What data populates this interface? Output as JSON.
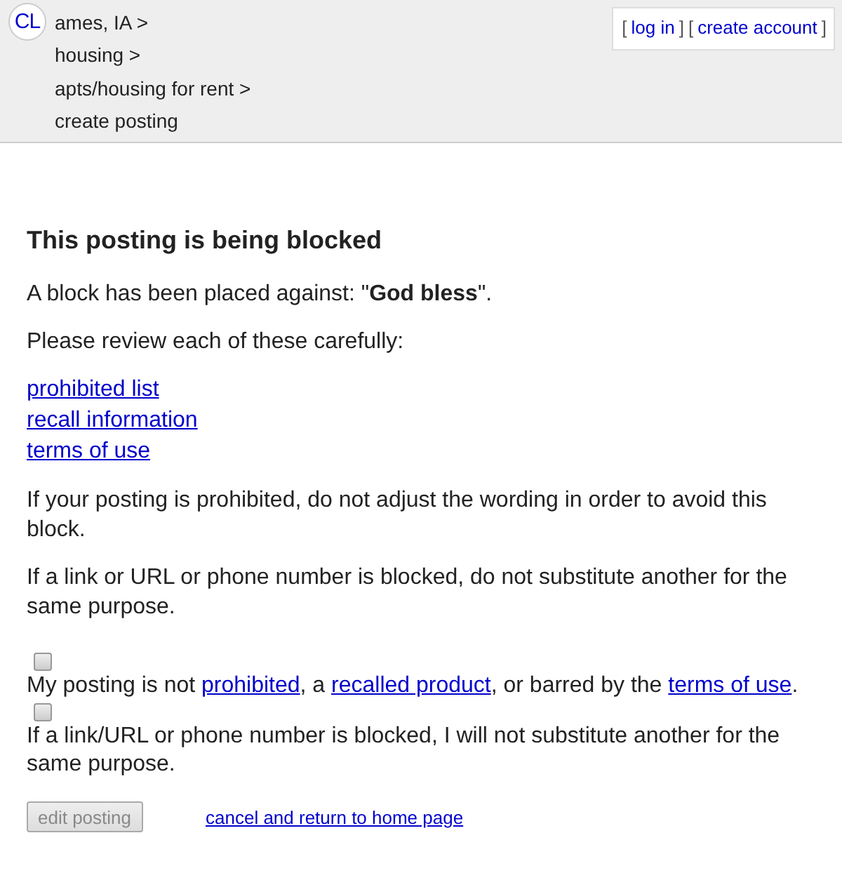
{
  "header": {
    "logo": "CL",
    "breadcrumbs": [
      "ames, IA >",
      "housing >",
      "apts/housing for rent >",
      "create posting"
    ],
    "account_links": [
      {
        "kind": "bracket",
        "text": "["
      },
      {
        "kind": "link",
        "text": "log in"
      },
      {
        "kind": "bracket",
        "text": "]"
      },
      {
        "kind": "bracket",
        "text": "["
      },
      {
        "kind": "link",
        "text": "create account"
      },
      {
        "kind": "bracket",
        "text": "]"
      }
    ]
  },
  "heading": "This posting is being blocked",
  "block_notice": "A block has been placed against: \"**God bless**\".",
  "review_prompt": "Please review each of these carefully:",
  "review_links": [
    "prohibited list",
    "recall information",
    "terms of use"
  ],
  "warnings": [
    "If your posting is prohibited, do not adjust the wording in order to avoid this block.",
    "If a link or URL or phone number is blocked, do not substitute another for the same purpose."
  ],
  "agreements": [
    {
      "checked": false,
      "segments": [
        {
          "kind": "text",
          "text": "My posting is not "
        },
        {
          "kind": "link",
          "text": "prohibited"
        },
        {
          "kind": "text",
          "text": ", a "
        },
        {
          "kind": "link",
          "text": "recalled product"
        },
        {
          "kind": "text",
          "text": ", or barred by the "
        },
        {
          "kind": "link",
          "text": "terms of use"
        },
        {
          "kind": "text",
          "text": "."
        }
      ]
    },
    {
      "checked": false,
      "segments": [
        {
          "kind": "text",
          "text": "If a link/URL or phone number is blocked, I will not substitute another for the same purpose."
        }
      ]
    }
  ],
  "actions": {
    "edit_button": {
      "label": "edit posting",
      "disabled": true
    },
    "cancel_link": "cancel and return to home page"
  }
}
